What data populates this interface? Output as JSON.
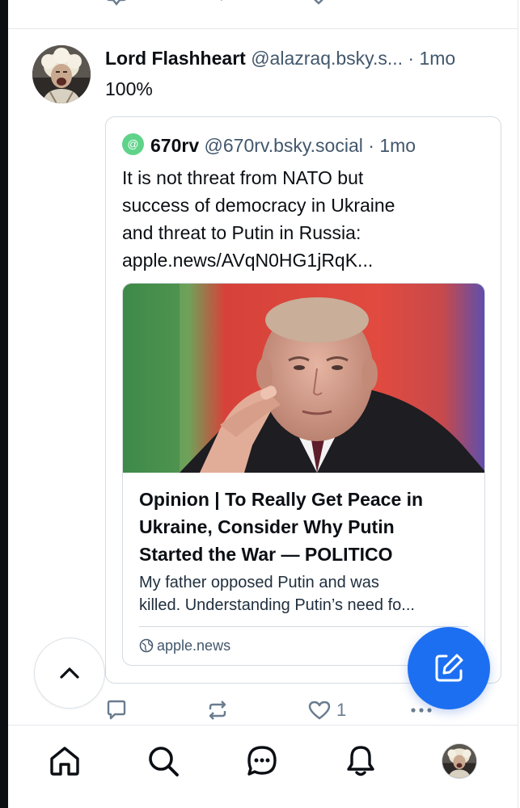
{
  "post": {
    "author_name": "Lord Flashheart",
    "handle": "@alazraq.bsky.s...",
    "separator": "·",
    "time": "1mo",
    "text": "100%"
  },
  "quote": {
    "avatar_glyph": "@",
    "author_name": "670rv",
    "handle": "@670rv.bsky.social",
    "separator": "·",
    "time": "1mo",
    "text_lines": [
      "It is not threat from NATO but",
      "success of democracy in Ukraine",
      "and threat to Putin in Russia:",
      "apple.news/AVqN0HG1jRqK..."
    ]
  },
  "link_card": {
    "title_lines": [
      "Opinion | To Really Get Peace in",
      "Ukraine, Consider Why Putin",
      "Started the War — POLITICO"
    ],
    "description_lines": [
      "My father opposed Putin and was",
      "killed. Understanding Putin’s need fo..."
    ],
    "domain": "apple.news"
  },
  "actions": {
    "reply_count": "",
    "repost_count": "",
    "like_count": "1"
  },
  "icons": {
    "reply": "reply-icon",
    "repost": "repost-icon",
    "like": "heart-icon",
    "more": "more-icon",
    "compose": "compose-icon",
    "scroll_top": "chevron-up-icon",
    "nav": [
      "home-icon",
      "search-icon",
      "chat-icon",
      "bell-icon",
      "profile-avatar"
    ]
  },
  "colors": {
    "accent": "#1d6ff2",
    "text_secondary": "#42576c",
    "icon_gray": "#6a7c8f",
    "border": "#d4dbe2"
  }
}
